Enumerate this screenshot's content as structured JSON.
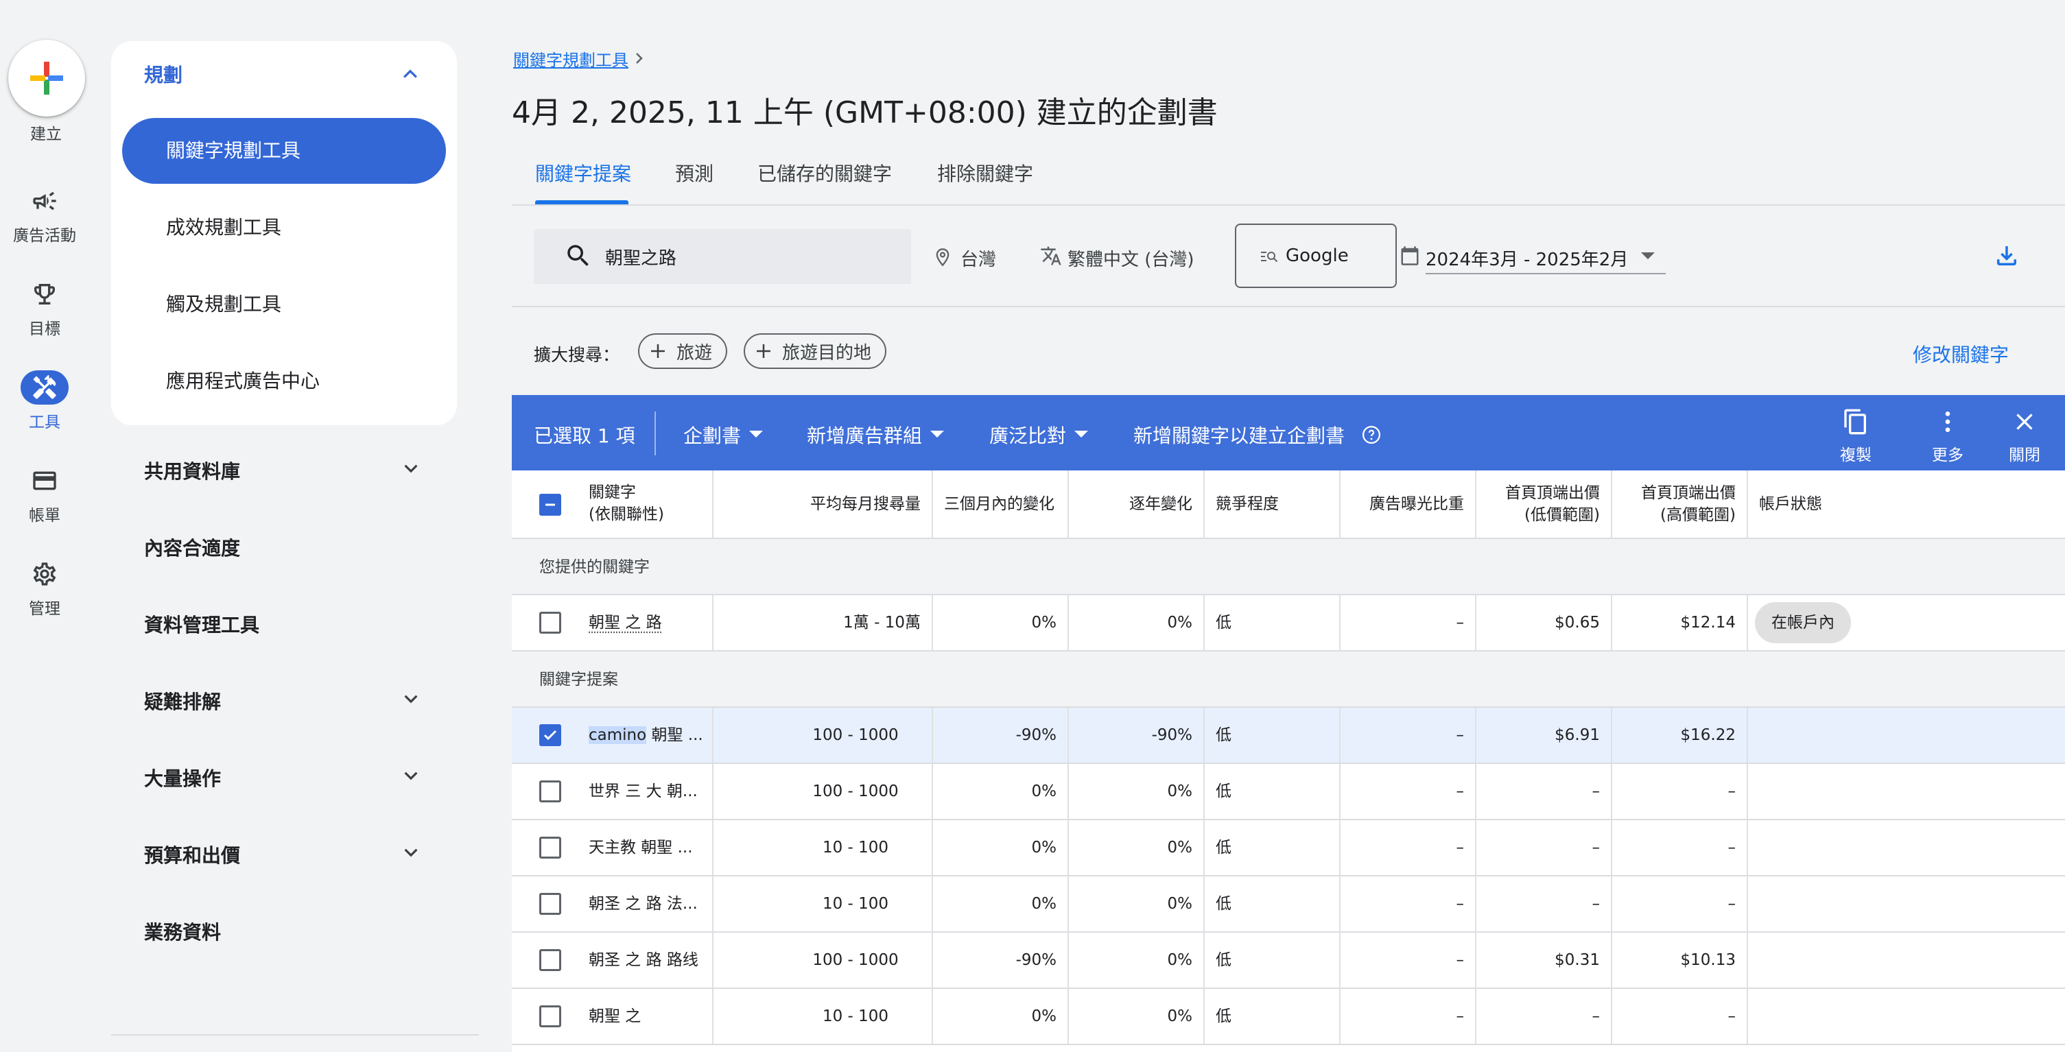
{
  "rail": {
    "create": "建立",
    "items": [
      {
        "label": "廣告活動",
        "icon": "megaphone-icon"
      },
      {
        "label": "目標",
        "icon": "trophy-icon"
      },
      {
        "label": "工具",
        "icon": "tools-icon"
      },
      {
        "label": "帳單",
        "icon": "credit-card-icon"
      },
      {
        "label": "管理",
        "icon": "gear-icon"
      }
    ]
  },
  "nav": {
    "planning": {
      "label": "規劃",
      "items": [
        "關鍵字規劃工具",
        "成效規劃工具",
        "觸及規劃工具",
        "應用程式廣告中心"
      ]
    },
    "sections": [
      "共用資料庫",
      "內容合適度",
      "資料管理工具",
      "疑難排解",
      "大量操作",
      "預算和出價",
      "業務資料"
    ]
  },
  "header": {
    "breadcrumb": "關鍵字規劃工具",
    "title": "4月 2, 2025, 11 上午 (GMT+08:00) 建立的企劃書"
  },
  "tabs": [
    "關鍵字提案",
    "預測",
    "已儲存的關鍵字",
    "排除關鍵字"
  ],
  "filters": {
    "search": "朝聖之路",
    "location": "台灣",
    "language": "繁體中文 (台灣)",
    "network": "Google",
    "date_range": "2024年3月 - 2025年2月"
  },
  "broaden": {
    "label": "擴大搜尋：",
    "chips": [
      "旅遊",
      "旅遊目的地"
    ],
    "refine": "修改關鍵字"
  },
  "selection_bar": {
    "count": "已選取 1 項",
    "plan": "企劃書",
    "add_ad_group": "新增廣告群組",
    "match_type": "廣泛比對",
    "add_to_plan": "新增關鍵字以建立企劃書",
    "copy": "複製",
    "more": "更多",
    "close": "關閉"
  },
  "table": {
    "headers": {
      "keyword": "關鍵字",
      "keyword_sub": "(依關聯性)",
      "avg_searches": "平均每月搜尋量",
      "three_month": "三個月內的變化",
      "yoy": "逐年變化",
      "competition": "競爭程度",
      "impression_share": "廣告曝光比重",
      "bid_low": "首頁頂端出價",
      "bid_low_sub": "(低價範圍)",
      "bid_high": "首頁頂端出價",
      "bid_high_sub": "(高價範圍)",
      "account_status": "帳戶狀態"
    },
    "provided_group": "您提供的關鍵字",
    "provided": {
      "keyword": "朝聖 之 路",
      "searches": "1萬 - 10萬",
      "three_month": "0%",
      "yoy": "0%",
      "competition": "低",
      "impression_share": "–",
      "bid_low": "$0.65",
      "bid_high": "$12.14",
      "status": "在帳戶內"
    },
    "ideas_group": "關鍵字提案",
    "ideas": [
      {
        "kw_hl": "camino",
        "keyword": " 朝聖 ...",
        "searches": "100 - 1000",
        "three_month": "-90%",
        "yoy": "-90%",
        "competition": "低",
        "impression_share": "–",
        "bid_low": "$6.91",
        "bid_high": "$16.22"
      },
      {
        "kw_hl": "",
        "keyword": "世界 三 大 朝...",
        "searches": "100 - 1000",
        "three_month": "0%",
        "yoy": "0%",
        "competition": "低",
        "impression_share": "–",
        "bid_low": "–",
        "bid_high": "–"
      },
      {
        "kw_hl": "",
        "keyword": "天主教 朝聖 ...",
        "searches": "10 - 100",
        "three_month": "0%",
        "yoy": "0%",
        "competition": "低",
        "impression_share": "–",
        "bid_low": "–",
        "bid_high": "–"
      },
      {
        "kw_hl": "",
        "keyword": "朝圣 之 路 法...",
        "searches": "10 - 100",
        "three_month": "0%",
        "yoy": "0%",
        "competition": "低",
        "impression_share": "–",
        "bid_low": "–",
        "bid_high": "–"
      },
      {
        "kw_hl": "",
        "keyword": "朝圣 之 路 路线",
        "searches": "100 - 1000",
        "three_month": "-90%",
        "yoy": "0%",
        "competition": "低",
        "impression_share": "–",
        "bid_low": "$0.31",
        "bid_high": "$10.13"
      },
      {
        "kw_hl": "",
        "keyword": "朝聖 之",
        "searches": "10 - 100",
        "three_month": "0%",
        "yoy": "0%",
        "competition": "低",
        "impression_share": "–",
        "bid_low": "–",
        "bid_high": "–"
      }
    ]
  },
  "colors": {
    "accent": "#1a73e8",
    "selection_bar": "#3f6fd8",
    "active_nav": "#3367d6"
  }
}
